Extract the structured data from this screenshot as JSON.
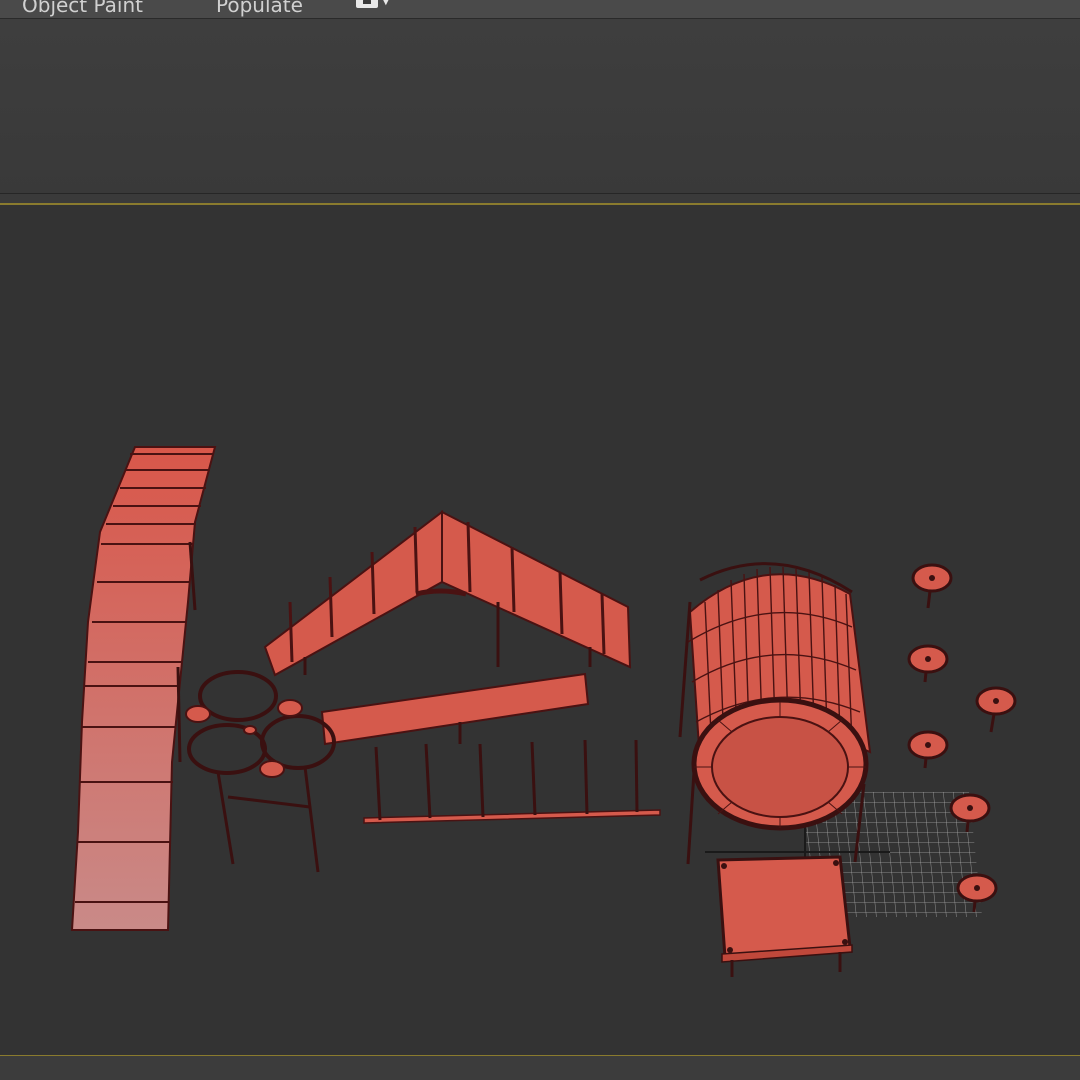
{
  "menubar": {
    "tabs": [
      {
        "label": "Object Paint"
      },
      {
        "label": "Populate"
      }
    ],
    "viewport_layout_icon": "viewport-layout-icon",
    "dropdown_icon": "chevron-down-icon"
  },
  "colors": {
    "object_fill": "#d55a4c",
    "object_edge": "#4a1212",
    "viewport_bg": "#333333",
    "active_border": "#8a7b2e",
    "grid": "#bdbdbd"
  }
}
